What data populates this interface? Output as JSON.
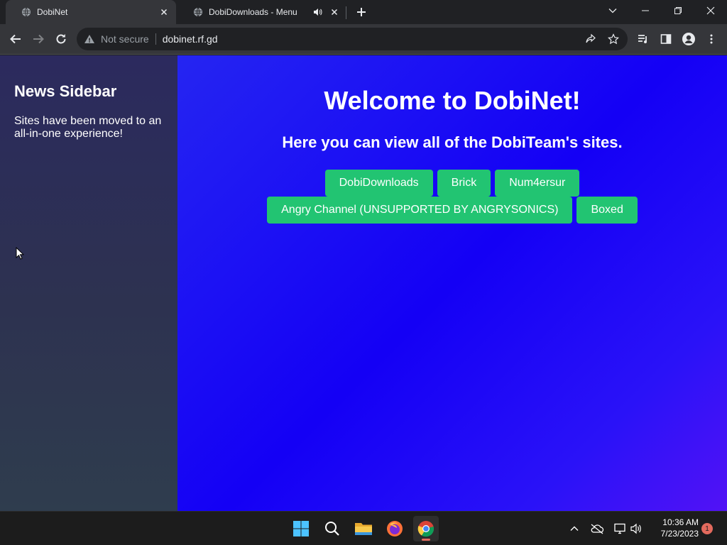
{
  "browser": {
    "tabs": [
      {
        "title": "DobiNet",
        "favicon": "globe-icon",
        "active": true
      },
      {
        "title": "DobiDownloads - Menu",
        "favicon": "globe-icon",
        "audio": "speaker-icon",
        "active": false
      }
    ],
    "omnibox": {
      "security_label": "Not secure",
      "url": "dobinet.rf.gd"
    }
  },
  "page": {
    "sidebar": {
      "heading": "News Sidebar",
      "text": "Sites have been moved to an all-in-one experience!"
    },
    "heading": "Welcome to DobiNet!",
    "subheading": "Here you can view all of the DobiTeam's sites.",
    "buttons_row1": [
      "DobiDownloads",
      "Brick",
      "Num4ersur"
    ],
    "buttons_row2": [
      "Angry Channel (UNSUPPORTED BY ANGRYSONICS)",
      "Boxed"
    ],
    "colors": {
      "button": "#22c472",
      "sidebar": "#2c2a5e",
      "main": "#1400f5"
    }
  },
  "taskbar": {
    "apps": [
      "windows-start-icon",
      "search-icon",
      "file-explorer-icon",
      "firefox-icon",
      "chrome-icon"
    ],
    "active_app": "chrome-icon",
    "clock": {
      "time": "10:36 AM",
      "date": "7/23/2023"
    },
    "notification_count": "1"
  }
}
